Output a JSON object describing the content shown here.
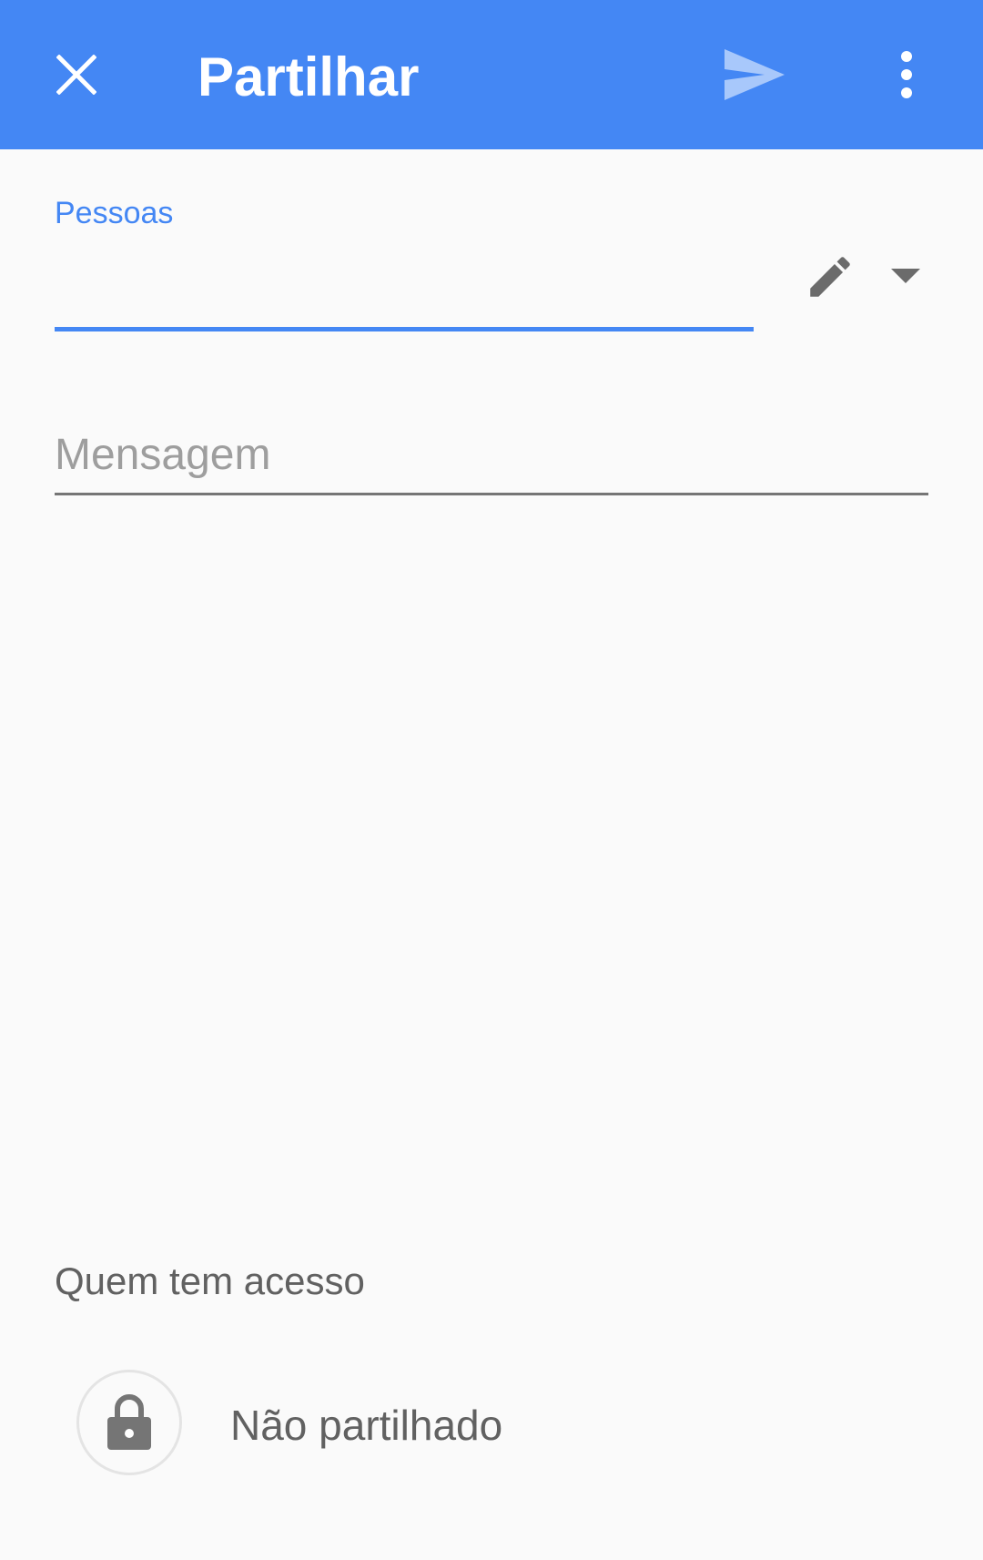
{
  "app_bar": {
    "title": "Partilhar",
    "background_color": "#4487f4",
    "close_icon": "close-icon",
    "send_icon": "send-icon",
    "more_icon": "more-vert-icon"
  },
  "people_field": {
    "label": "Pessoas",
    "value": "",
    "accent_color": "#4487f4",
    "edit_icon": "pencil-icon",
    "dropdown_icon": "arrow-drop-down-icon"
  },
  "message_field": {
    "value": "",
    "placeholder": "Mensagem"
  },
  "access": {
    "heading": "Quem tem acesso",
    "status": "Não partilhado",
    "status_icon": "lock-icon"
  }
}
